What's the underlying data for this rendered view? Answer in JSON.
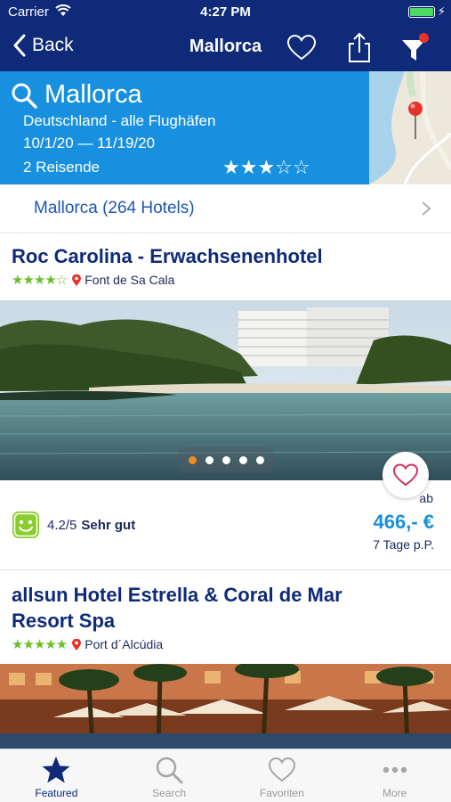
{
  "status_bar": {
    "carrier": "Carrier",
    "time": "4:27 PM"
  },
  "nav": {
    "back_label": "Back",
    "title": "Mallorca"
  },
  "search": {
    "destination": "Mallorca",
    "airports": "Deutschland - alle Flughäfen",
    "dates": "10/1/20 — 11/19/20",
    "travelers": "2 Reisende",
    "stars": "★★★☆☆"
  },
  "region": {
    "label": "Mallorca (264 Hotels)"
  },
  "hotels": [
    {
      "name": "Roc Carolina - Erwachsenenhotel",
      "stars": "★★★★☆",
      "location": "Font de Sa Cala",
      "rating_score": "4.2/5",
      "rating_label": "Sehr gut",
      "price_prefix": "ab",
      "price": "466,- €",
      "price_note": "7 Tage p.P."
    },
    {
      "name_line1": "allsun Hotel Estrella & Coral de Mar",
      "name_line2": "Resort Spa",
      "stars": "★★★★★",
      "location": "Port d´Alcúdia"
    }
  ],
  "tabs": [
    {
      "label": "Featured"
    },
    {
      "label": "Search"
    },
    {
      "label": "Favoriten"
    },
    {
      "label": "More"
    }
  ],
  "colors": {
    "nav_bg": "#0e2a78",
    "header_blue": "#1890e0",
    "price_blue": "#1a8fe0",
    "rating_green": "#6bbf2a",
    "badge_red": "#e8322c"
  }
}
